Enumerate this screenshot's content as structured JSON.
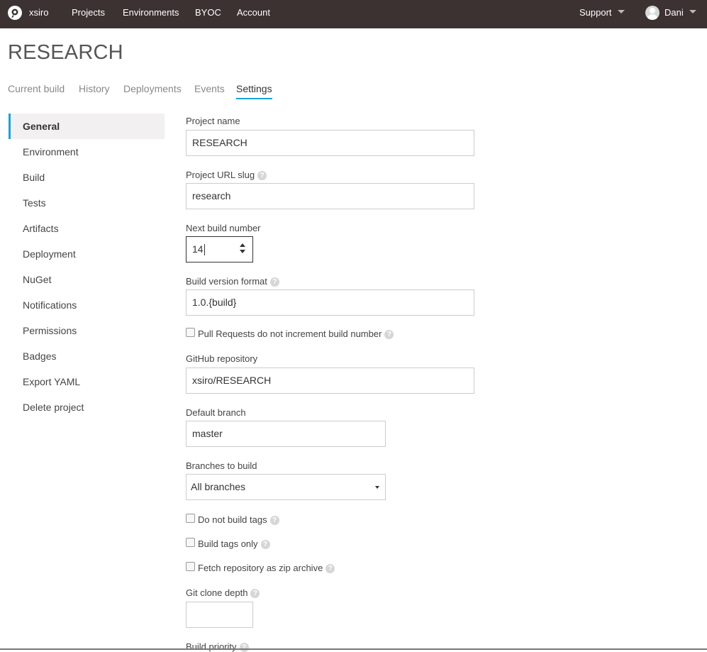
{
  "topbar": {
    "brand": "xsiro",
    "nav": [
      "Projects",
      "Environments",
      "BYOC",
      "Account"
    ],
    "support": "Support",
    "user": "Dani",
    "colors": {
      "background": "#3b3231"
    }
  },
  "page": {
    "title": "RESEARCH",
    "tabs": [
      "Current build",
      "History",
      "Deployments",
      "Events",
      "Settings"
    ],
    "active_tab": "Settings",
    "accent_color": "#1aa3d8"
  },
  "sidebar": {
    "items": [
      "General",
      "Environment",
      "Build",
      "Tests",
      "Artifacts",
      "Deployment",
      "NuGet",
      "Notifications",
      "Permissions",
      "Badges",
      "Export YAML",
      "Delete project"
    ],
    "active": "General"
  },
  "form": {
    "project_name": {
      "label": "Project name",
      "value": "RESEARCH"
    },
    "url_slug": {
      "label": "Project URL slug",
      "value": "research"
    },
    "next_build": {
      "label": "Next build number",
      "value": "14"
    },
    "version_format": {
      "label": "Build version format",
      "value": "1.0.{build}"
    },
    "pr_checkbox": {
      "label": "Pull Requests do not increment build number",
      "checked": false
    },
    "github_repo": {
      "label": "GitHub repository",
      "value": "xsiro/RESEARCH"
    },
    "default_branch": {
      "label": "Default branch",
      "value": "master"
    },
    "branches_to_build": {
      "label": "Branches to build",
      "value": "All branches"
    },
    "no_build_tags": {
      "label": "Do not build tags",
      "checked": false
    },
    "build_tags_only": {
      "label": "Build tags only",
      "checked": false
    },
    "fetch_zip": {
      "label": "Fetch repository as zip archive",
      "checked": false
    },
    "clone_depth": {
      "label": "Git clone depth",
      "value": ""
    },
    "build_priority": {
      "label": "Build priority"
    }
  },
  "icons": {
    "help": "?"
  }
}
